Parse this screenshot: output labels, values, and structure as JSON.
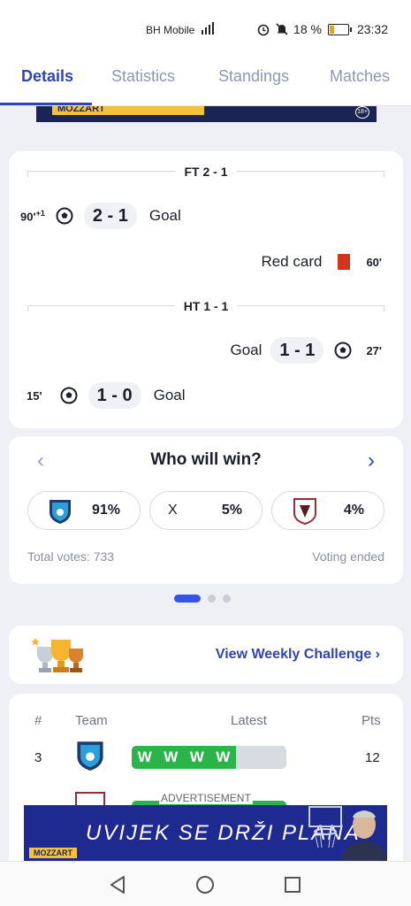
{
  "status_bar": {
    "carrier": "BH Mobile",
    "battery": "18 %",
    "time": "23:32"
  },
  "tabs": [
    {
      "label": "Details",
      "active": true
    },
    {
      "label": "Statistics",
      "active": false
    },
    {
      "label": "Standings",
      "active": false
    },
    {
      "label": "Matches",
      "active": false
    }
  ],
  "top_ad": {
    "brand": "MOZZART",
    "badge": "18+"
  },
  "events": {
    "ft_label": "FT 2 - 1",
    "ht_label": "HT 1 - 1",
    "items": [
      {
        "minute": "90'",
        "added": "+1",
        "score": "2 - 1",
        "type": "Goal"
      },
      {
        "type": "Red card",
        "minute": "60'"
      },
      {
        "type": "Goal",
        "score": "1 - 1",
        "minute": "27'"
      },
      {
        "minute": "15'",
        "score": "1 - 0",
        "type": "Goal"
      }
    ]
  },
  "vote": {
    "title": "Who will win?",
    "home_pct": "91%",
    "draw_label": "X",
    "draw_pct": "5%",
    "away_pct": "4%",
    "total": "Total votes: 733",
    "status": "Voting ended"
  },
  "weekly": {
    "link": "View Weekly Challenge"
  },
  "standings": {
    "headers": {
      "rank": "#",
      "team": "Team",
      "latest": "Latest",
      "pts": "Pts"
    },
    "rows": [
      {
        "rank": "3",
        "form": [
          "W",
          "W",
          "W",
          "W"
        ],
        "pts": "12"
      }
    ]
  },
  "ad": {
    "label": "ADVERTISEMENT",
    "slogan": "UVIJEK SE DRŽI PLANA",
    "brand": "MOZZART"
  },
  "colors": {
    "accent": "#2f44b8",
    "win": "#2bb44a",
    "red_card": "#d2341c"
  }
}
